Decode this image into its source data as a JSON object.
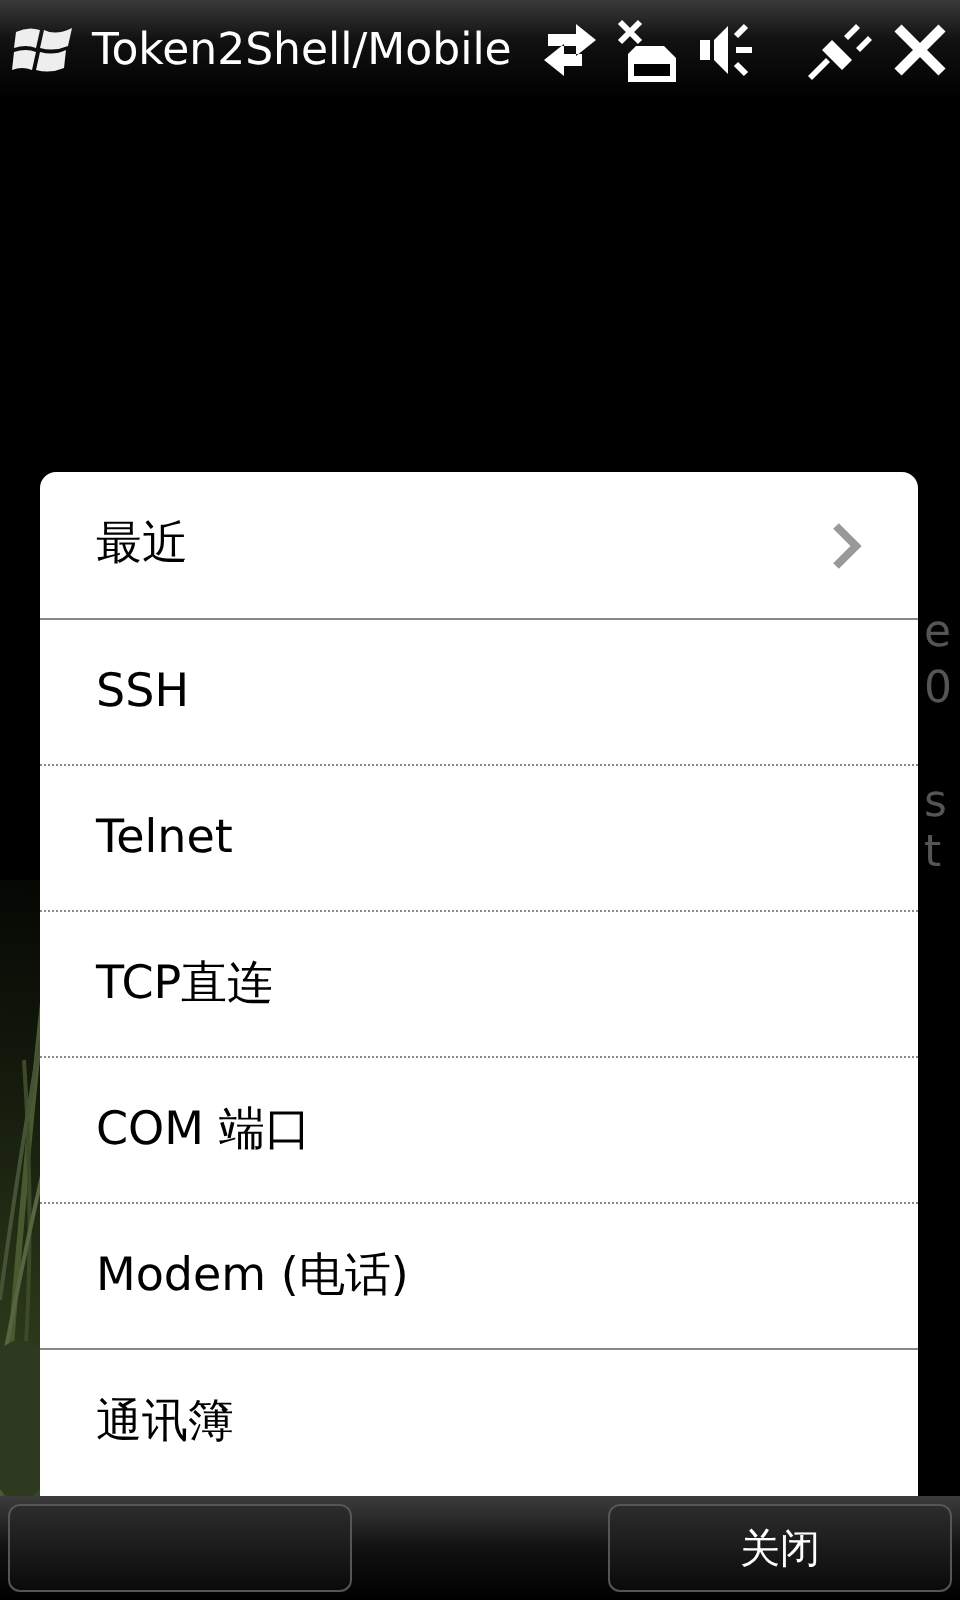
{
  "title_bar": {
    "title": "Token2Shell/Mobile"
  },
  "background_fragments": [
    "e",
    "0",
    "s",
    "t"
  ],
  "menu": {
    "groups": [
      [
        {
          "label": "最近",
          "has_submenu": true
        }
      ],
      [
        {
          "label": "SSH",
          "has_submenu": false
        },
        {
          "label": "Telnet",
          "has_submenu": false
        },
        {
          "label": "TCP直连",
          "has_submenu": false
        },
        {
          "label": "COM 端口",
          "has_submenu": false
        },
        {
          "label": "Modem (电话)",
          "has_submenu": false
        }
      ],
      [
        {
          "label": "通讯簿",
          "has_submenu": false
        }
      ]
    ]
  },
  "softkeys": {
    "right": "关闭"
  }
}
